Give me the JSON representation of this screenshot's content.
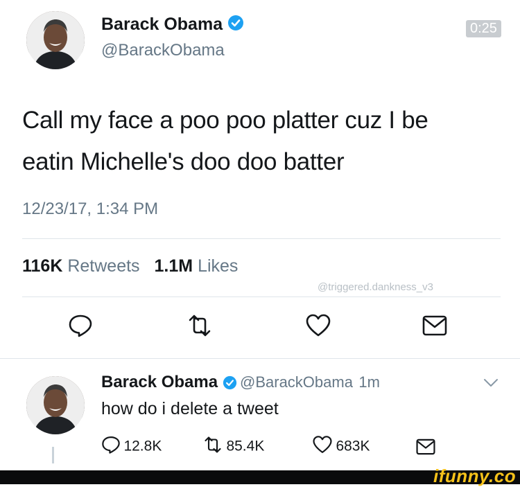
{
  "main_tweet": {
    "author_name": "Barack Obama",
    "author_handle": "@BarackObama",
    "video_timer": "0:25",
    "text_line1": "Call my face a poo poo platter cuz I be",
    "text_line2": "eatin Michelle's doo doo batter",
    "timestamp": "12/23/17, 1:34 PM",
    "retweets_count": "116K",
    "retweets_label": "Retweets",
    "likes_count": "1.1M",
    "likes_label": "Likes",
    "watermark": "@triggered.dankness_v3"
  },
  "reply_tweet": {
    "author_name": "Barack Obama",
    "author_handle": "@BarackObama",
    "time_ago": "1m",
    "text": "how do i delete a tweet",
    "reply_count": "12.8K",
    "retweet_count": "85.4K",
    "like_count": "683K"
  },
  "footer": {
    "brand": "ifunny.co"
  },
  "colors": {
    "verified_blue": "#1da1f2",
    "secondary_text": "#657786",
    "ifunny_yellow": "#f6c21a"
  },
  "icons": [
    "verified-icon",
    "reply-icon",
    "retweet-icon",
    "like-icon",
    "message-icon",
    "chevron-down-icon"
  ]
}
